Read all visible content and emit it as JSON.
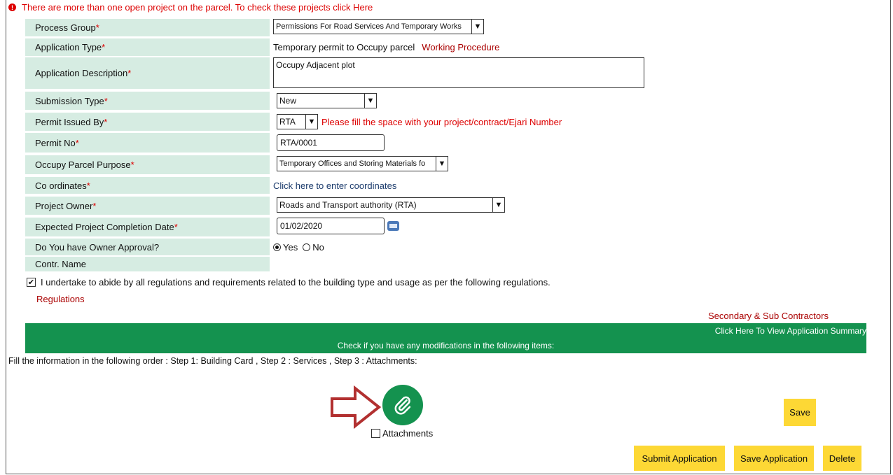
{
  "warning": "There are more than one open project on the parcel. To check these projects click Here",
  "fields": {
    "process_group": {
      "label": "Process Group",
      "value": "Permissions For Road Services And Temporary Works"
    },
    "application_type": {
      "label": "Application Type ",
      "value": "Temporary permit to Occupy parcel",
      "link": "Working Procedure"
    },
    "application_description": {
      "label": "Application Description",
      "value": "Occupy Adjacent plot"
    },
    "submission_type": {
      "label": "Submission Type ",
      "value": "New"
    },
    "permit_issued_by": {
      "label": "Permit Issued By",
      "value": "RTA",
      "hint": "Please fill the space with your project/contract/Ejari Number"
    },
    "permit_no": {
      "label": "Permit No",
      "value": "RTA/0001"
    },
    "occupy_parcel_purpose": {
      "label": "Occupy Parcel Purpose",
      "value": "Temporary Offices and Storing Materials fo"
    },
    "coordinates": {
      "label": "Co ordinates",
      "link": "Click here to enter coordinates"
    },
    "project_owner": {
      "label": "Project Owner",
      "value": "Roads and Transport authority (RTA)"
    },
    "completion_date": {
      "label": "Expected Project Completion Date",
      "value": "01/02/2020"
    },
    "owner_approval": {
      "label": "Do You have Owner Approval?",
      "yes": "Yes",
      "no": "No",
      "selected": "Yes"
    },
    "contr_name": {
      "label": "Contr. Name"
    }
  },
  "required_mark": "*",
  "undertake": {
    "text": "I undertake to abide by all regulations and requirements related to the building type and usage as per the following regulations.",
    "checked": true
  },
  "regulations_link": "Regulations",
  "secondary_link": "Secondary & Sub Contractors",
  "summary_link": "Click Here To View Application Summary",
  "modifications_text": "Check if you have any modifications in the following items:",
  "order_text": "Fill the information in the following order : Step 1: Building Card , Step 2 : Services , Step 3 : Attachments:",
  "attachments_label": "Attachments",
  "buttons": {
    "save": "Save",
    "submit": "Submit Application",
    "save_application": "Save Application",
    "delete": "Delete"
  },
  "colors": {
    "label_bg": "#d6ece2",
    "green_bar": "#14924f",
    "button": "#fdd835",
    "required": "#dd0000"
  }
}
